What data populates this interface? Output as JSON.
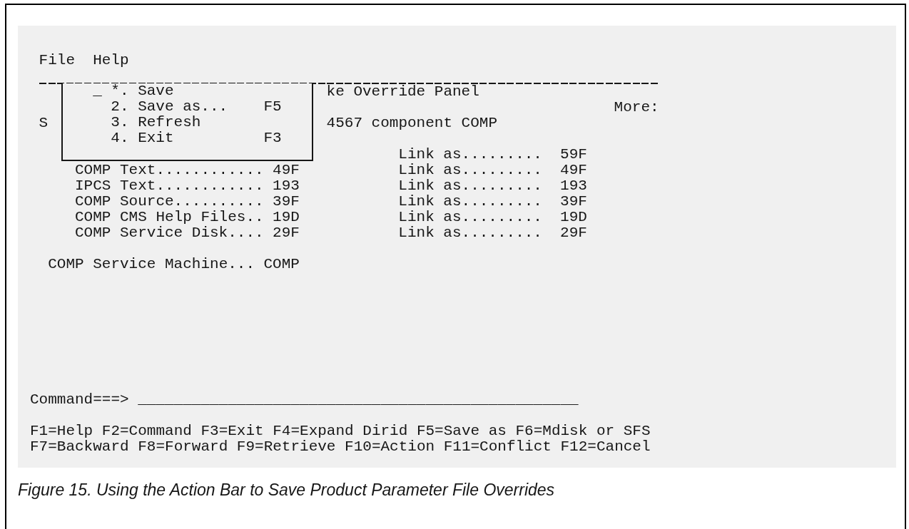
{
  "action_bar": [
    {
      "label": "File"
    },
    {
      "label": "Help"
    }
  ],
  "pulldown_menu": {
    "selection_field": "_",
    "items": [
      {
        "number": "*.",
        "label": "Save"
      },
      {
        "number": "2.",
        "label": "Save as...",
        "key": "F5"
      },
      {
        "number": "3.",
        "label": "Refresh"
      },
      {
        "number": "4.",
        "label": "Exit",
        "key": "F3"
      }
    ]
  },
  "panel": {
    "title": "ke Override Panel",
    "more": "More:",
    "row_label": "S",
    "subtitle": "4567 component COMP",
    "fields": [
      {
        "link_label": "Link as.........",
        "link_value": "59F"
      },
      {
        "label": "COMP Text............",
        "value": "49F",
        "link_label": "Link as.........",
        "link_value": "49F"
      },
      {
        "label": "IPCS Text............",
        "value": "193",
        "link_label": "Link as.........",
        "link_value": "193"
      },
      {
        "label": "COMP Source..........",
        "value": "39F",
        "link_label": "Link as.........",
        "link_value": "39F"
      },
      {
        "label": "COMP CMS Help Files..",
        "value": "19D",
        "link_label": "Link as.........",
        "link_value": "19D"
      },
      {
        "label": "COMP Service Disk....",
        "value": "29F",
        "link_label": "Link as.........",
        "link_value": "29F"
      }
    ],
    "service_machine": {
      "label": "COMP Service Machine...",
      "value": "COMP"
    }
  },
  "command": {
    "label": "Command===>",
    "field": "_________________________________________________"
  },
  "function_keys": [
    "F1=Help F2=Command F3=Exit F4=Expand Dirid F5=Save as F6=Mdisk or SFS",
    "F7=Backward F8=Forward F9=Retrieve F10=Action F11=Conflict F12=Cancel"
  ],
  "caption": "Figure 15. Using the Action Bar to Save Product Parameter File Overrides"
}
